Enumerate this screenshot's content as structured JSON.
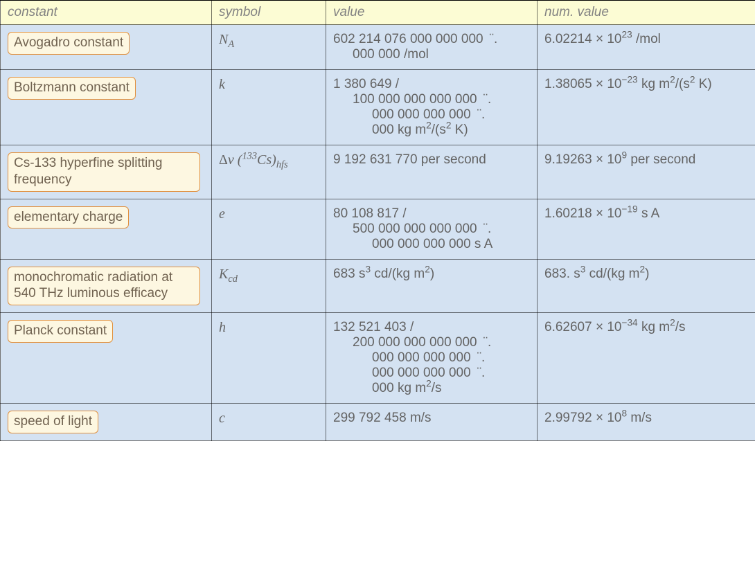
{
  "headers": {
    "constant": "constant",
    "symbol": "symbol",
    "value": "value",
    "num_value": "num. value"
  },
  "rows": [
    {
      "name": "Avogadro constant",
      "symbol_html": "<i>N<sub>A</sub></i>",
      "value_html": "<span class='line'>602 214 076 000 000 000  ¨.</span><span class='line ind1'>000 000 /mol</span>",
      "num_html": "6.02214 × 10<sup>23</sup> /mol"
    },
    {
      "name": "Boltzmann constant",
      "symbol_html": "<i>k</i>",
      "value_html": "<span class='line'>1 380 649 /</span><span class='line ind1'>100 000 000 000 000  ¨.</span><span class='line ind2'>000 000 000 000  ¨.</span><span class='line ind2'>000 kg m<sup>2</sup>/(s<sup>2</sup> K)</span>",
      "num_html": "1.38065 × 10<sup>−23</sup> kg m<sup>2</sup>/(s<sup>2</sup> K)"
    },
    {
      "name": "Cs-133 hyperfine splitting frequency",
      "symbol_html": "<span class='upright'>Δ</span><i>ν</i> (<sup>133</sup>Cs)<sub>hfs</sub>",
      "value_html": "<span class='line'>9 192 631 770 per second</span>",
      "num_html": "9.19263 × 10<sup>9</sup> per second"
    },
    {
      "name": "elementary charge",
      "symbol_html": "<i>e</i>",
      "value_html": "<span class='line'>80 108 817 /</span><span class='line ind1'>500 000 000 000 000  ¨.</span><span class='line ind2'>000 000 000 000 s A</span>",
      "num_html": "1.60218 × 10<sup>−19</sup> s A"
    },
    {
      "name": "monochromatic radiation at 540 THz luminous efficacy",
      "symbol_html": "<i>K<sub>cd</sub></i>",
      "value_html": "<span class='line'>683 s<sup>3</sup> cd/(kg m<sup>2</sup>)</span>",
      "num_html": "683. s<sup>3</sup> cd/(kg m<sup>2</sup>)"
    },
    {
      "name": "Planck constant",
      "symbol_html": "<i>h</i>",
      "value_html": "<span class='line'>132 521 403 /</span><span class='line ind1'>200 000 000 000 000  ¨.</span><span class='line ind2'>000 000 000 000  ¨.</span><span class='line ind2'>000 000 000 000  ¨.</span><span class='line ind2'>000 kg m<sup>2</sup>/s</span>",
      "num_html": "6.62607 × 10<sup>−34</sup> kg m<sup>2</sup>/s"
    },
    {
      "name": "speed of light",
      "symbol_html": "<i>c</i>",
      "value_html": "<span class='line'>299 792 458 m/s</span>",
      "num_html": "2.99792 × 10<sup>8</sup> m/s"
    }
  ]
}
